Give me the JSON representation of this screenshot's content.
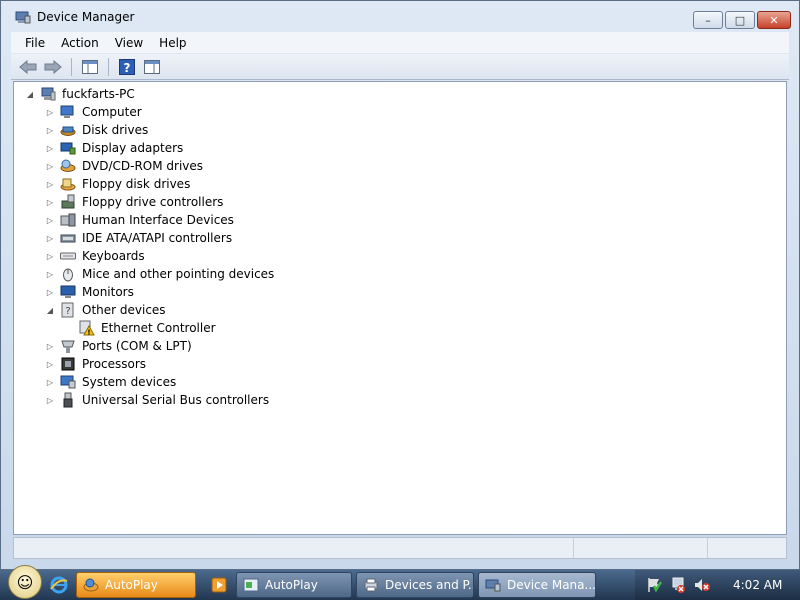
{
  "window": {
    "title": "Device Manager",
    "controls": {
      "minimize": "–",
      "maximize": "□",
      "close": "✕"
    }
  },
  "menu": [
    "File",
    "Action",
    "View",
    "Help"
  ],
  "toolbar": {
    "buttons": [
      "back-arrow-icon",
      "forward-arrow-icon",
      "show-hide-console-tree-icon",
      "help-icon",
      "properties-pane-icon"
    ]
  },
  "tree": {
    "root": "fuckfarts-PC",
    "categories": [
      {
        "label": "Computer",
        "icon": "computer-icon",
        "expanded": false
      },
      {
        "label": "Disk drives",
        "icon": "disk-drive-icon",
        "expanded": false
      },
      {
        "label": "Display adapters",
        "icon": "display-adapter-icon",
        "expanded": false
      },
      {
        "label": "DVD/CD-ROM drives",
        "icon": "dvd-drive-icon",
        "expanded": false
      },
      {
        "label": "Floppy disk drives",
        "icon": "floppy-disk-icon",
        "expanded": false
      },
      {
        "label": "Floppy drive controllers",
        "icon": "floppy-controller-icon",
        "expanded": false
      },
      {
        "label": "Human Interface Devices",
        "icon": "hid-icon",
        "expanded": false
      },
      {
        "label": "IDE ATA/ATAPI controllers",
        "icon": "ide-controller-icon",
        "expanded": false
      },
      {
        "label": "Keyboards",
        "icon": "keyboard-icon",
        "expanded": false
      },
      {
        "label": "Mice and other pointing devices",
        "icon": "mouse-icon",
        "expanded": false
      },
      {
        "label": "Monitors",
        "icon": "monitor-icon",
        "expanded": false
      },
      {
        "label": "Other devices",
        "icon": "unknown-device-icon",
        "expanded": true,
        "children": [
          "Ethernet Controller"
        ]
      },
      {
        "label": "Ports (COM & LPT)",
        "icon": "port-icon",
        "expanded": false
      },
      {
        "label": "Processors",
        "icon": "processor-icon",
        "expanded": false
      },
      {
        "label": "System devices",
        "icon": "system-devices-icon",
        "expanded": false
      },
      {
        "label": "Universal Serial Bus controllers",
        "icon": "usb-icon",
        "expanded": false
      }
    ]
  },
  "taskbar": {
    "items": [
      {
        "label": "AutoPlay",
        "style": "orange"
      },
      {
        "label": "AutoPlay",
        "style": "normal"
      },
      {
        "label": "Devices and P...",
        "style": "normal"
      },
      {
        "label": "Device Mana...",
        "style": "pressed"
      }
    ],
    "clock": "4:02 AM"
  }
}
